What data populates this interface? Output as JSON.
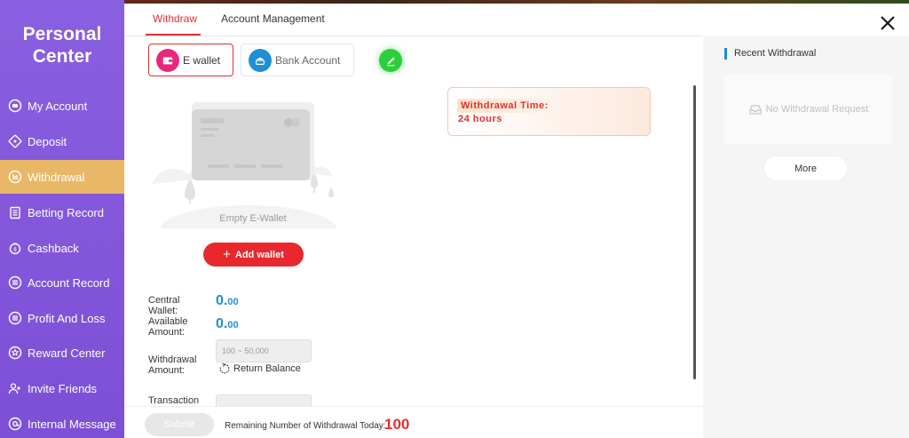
{
  "sidebar": {
    "title": "Personal Center",
    "items": [
      {
        "label": "My Account",
        "icon": "account-icon"
      },
      {
        "label": "Deposit",
        "icon": "deposit-icon"
      },
      {
        "label": "Withdrawal",
        "icon": "withdrawal-icon",
        "active": true
      },
      {
        "label": "Betting Record",
        "icon": "clipboard-icon"
      },
      {
        "label": "Cashback",
        "icon": "cashback-icon"
      },
      {
        "label": "Account Record",
        "icon": "ledger-icon"
      },
      {
        "label": "Profit And Loss",
        "icon": "profit-icon"
      },
      {
        "label": "Reward Center",
        "icon": "reward-icon"
      },
      {
        "label": "Invite Friends",
        "icon": "invite-icon"
      },
      {
        "label": "Internal Message",
        "icon": "at-icon"
      }
    ],
    "colors": {
      "bg": "#8a5fe0",
      "active": "#e8b866"
    }
  },
  "tabs": [
    {
      "label": "Withdraw",
      "active": true
    },
    {
      "label": "Account Management",
      "active": false
    }
  ],
  "methods": [
    {
      "label": "E wallet",
      "selected": true,
      "color": "#e8287c"
    },
    {
      "label": "Bank Account",
      "selected": false,
      "color": "#1e8fd6"
    }
  ],
  "empty": {
    "text": "Empty E-Wallet",
    "add_label": "Add wallet"
  },
  "withdrawal_time": {
    "label": "Withdrawal Time:",
    "value": "24 hours"
  },
  "form": {
    "central_wallet_label": "Central Wallet:",
    "central_wallet_int": "0.",
    "central_wallet_dec": "00",
    "available_label": "Available Amount:",
    "available_int": "0.",
    "available_dec": "00",
    "withdrawal_label": "Withdrawal Amount:",
    "withdrawal_placeholder": "100 ~ 50,000",
    "return_balance": "Return Balance",
    "transaction_label": "Transaction"
  },
  "footer": {
    "submit": "Submit",
    "remaining_label": "Remaining Number of Withdrawal Today:",
    "remaining_value": "100"
  },
  "recent": {
    "title": "Recent Withdrawal",
    "empty": "No Withdrawal Request",
    "more": "More"
  }
}
